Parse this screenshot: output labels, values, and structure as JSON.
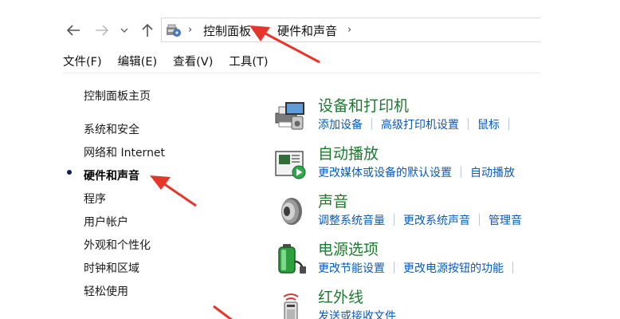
{
  "nav": {
    "back_icon": "back-arrow-icon",
    "forward_icon": "forward-arrow-icon",
    "recent_icon": "chevron-down-icon",
    "up_icon": "up-arrow-icon"
  },
  "address": {
    "location_icon": "control-panel-icon",
    "breadcrumbs": [
      "控制面板",
      "硬件和声音"
    ]
  },
  "menu": [
    "文件(F)",
    "编辑(E)",
    "查看(V)",
    "工具(T)"
  ],
  "sidebar": {
    "home": "控制面板主页",
    "items": [
      "系统和安全",
      "网络和 Internet",
      "硬件和声音",
      "程序",
      "用户帐户",
      "外观和个性化",
      "时钟和区域",
      "轻松使用"
    ],
    "current_index": 2
  },
  "categories": [
    {
      "title": "设备和打印机",
      "icon": "printer-icon",
      "links": [
        "添加设备",
        "高级打印机设置",
        "鼠标"
      ]
    },
    {
      "title": "自动播放",
      "icon": "autoplay-icon",
      "links": [
        "更改媒体或设备的默认设置",
        "自动播放"
      ]
    },
    {
      "title": "声音",
      "icon": "speaker-icon",
      "links": [
        "调整系统音量",
        "更改系统声音",
        "管理音"
      ]
    },
    {
      "title": "电源选项",
      "icon": "battery-icon",
      "links": [
        "更改节能设置",
        "更改电源按钮的功能"
      ]
    },
    {
      "title": "红外线",
      "icon": "infrared-icon",
      "links": [
        "发送或接收文件"
      ]
    }
  ],
  "colors": {
    "category_title": "#1e7a2f",
    "link": "#0a5bb8",
    "annotation_arrow": "#e8352b"
  }
}
